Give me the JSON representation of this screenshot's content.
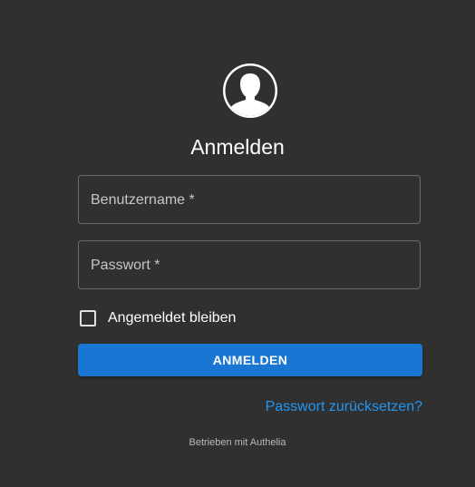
{
  "colors": {
    "background": "#303030",
    "primary": "#1976d2",
    "link": "#2196f3"
  },
  "avatar": {
    "icon": "user-silhouette-icon"
  },
  "title": "Anmelden",
  "form": {
    "username_label": "Benutzername *",
    "password_label": "Passwort *",
    "remember_label": "Angemeldet bleiben",
    "remember_checked": false,
    "submit_label": "ANMELDEN",
    "reset_link": "Passwort zurücksetzen?"
  },
  "footer": "Betrieben mit Authelia"
}
